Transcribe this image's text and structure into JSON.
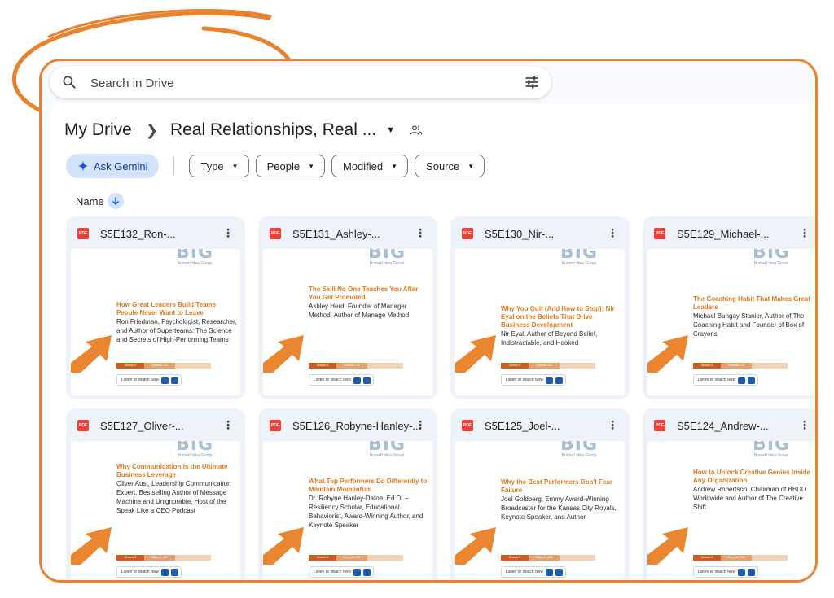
{
  "search": {
    "placeholder": "Search in Drive"
  },
  "breadcrumb": {
    "root": "My Drive",
    "current": "Real Relationships, Real ..."
  },
  "filters": {
    "gemini_label": "Ask Gemini",
    "chips": [
      "Type",
      "People",
      "Modified",
      "Source"
    ]
  },
  "sort": {
    "label": "Name"
  },
  "colors": {
    "accent": "#e8822e",
    "gemini_bg": "#d3e3fd",
    "doc_orange": "#e07a1f"
  },
  "icons": [
    "search-icon",
    "tune-icon",
    "chevron-right-icon",
    "dropdown-caret-icon",
    "shared-people-icon",
    "sparkle-icon",
    "arrow-down-icon",
    "pdf-icon",
    "more-vert-icon"
  ],
  "files": [
    {
      "name": "S5E132_Ron-...",
      "logo": "BIG",
      "logo_sub": "Burnett Idea Group",
      "title": "How Great Leaders Build Teams People Never Want to Leave",
      "subtitle": "Ron Friedman, Psychologist, Researcher, and Author of Superteams: The Science and Secrets of High-Performing Teams",
      "season": "Season 5",
      "episode": "Episode 132",
      "listen": "Listen or Watch Now"
    },
    {
      "name": "S5E131_Ashley-...",
      "logo": "BIG",
      "logo_sub": "Burnett Idea Group",
      "title": "The Skill No One Teaches You After You Get Promoted",
      "subtitle": "Ashley Herd, Founder of Manager Method, Author of Manage Method",
      "season": "Season 5",
      "episode": "Episode 131",
      "listen": "Listen or Watch Now"
    },
    {
      "name": "S5E130_Nir-...",
      "logo": "BIG",
      "logo_sub": "Burnett Idea Group",
      "title": "Why You Quit (And How to Stop): Nir Eyal on the Beliefs That Drive Business Development",
      "subtitle": "Nir Eyal, Author of Beyond Belief, Indistractable, and Hooked",
      "season": "Season 5",
      "episode": "Episode 130",
      "listen": "Listen or Watch Now"
    },
    {
      "name": "S5E129_Michael-...",
      "logo": "BIG",
      "logo_sub": "Burnett Idea Group",
      "title": "The Coaching Habit That Makes Great Leaders",
      "subtitle": "Michael Bungay Stanier, Author of The Coaching Habit and Founder of Box of Crayons",
      "season": "Season 5",
      "episode": "Episode 129",
      "listen": "Listen or Watch Now"
    },
    {
      "name": "S5E127_Oliver-...",
      "logo": "BIG",
      "logo_sub": "Burnett Idea Group",
      "title": "Why Communication Is the Ultimate Business Leverage",
      "subtitle": "Oliver Aust, Leadership Communication Expert, Bestselling Author of Message Machine and Unignorable, Host of the Speak Like a CEO Podcast",
      "season": "Season 5",
      "episode": "Episode 127",
      "listen": "Listen or Watch Now"
    },
    {
      "name": "S5E126_Robyne-Hanley-...",
      "logo": "BIG",
      "logo_sub": "Burnett Idea Group",
      "title": "What Top Performers Do Differently to Maintain Momentum",
      "subtitle": "Dr. Robyne Hanley-Dafoe, Ed.D. – Resiliency Scholar, Educational Behaviorist, Award-Winning Author, and Keynote Speaker",
      "season": "Season 5",
      "episode": "Episode 126",
      "listen": "Listen or Watch Now"
    },
    {
      "name": "S5E125_Joel-...",
      "logo": "BIG",
      "logo_sub": "Burnett Idea Group",
      "title": "Why the Best Performers Don't Fear Failure",
      "subtitle": "Joel Goldberg, Emmy Award-Winning Broadcaster for the Kansas City Royals, Keynote Speaker, and Author",
      "season": "Season 5",
      "episode": "Episode 125",
      "listen": "Listen or Watch Now"
    },
    {
      "name": "S5E124_Andrew-...",
      "logo": "BIG",
      "logo_sub": "Burnett Idea Group",
      "title": "How to Unlock Creative Genius Inside Any Organization",
      "subtitle": "Andrew Robertson, Chairman of BBDO Worldwide and Author of The Creative Shift",
      "season": "Season 5",
      "episode": "Episode 124",
      "listen": "Listen or Watch Now"
    }
  ]
}
